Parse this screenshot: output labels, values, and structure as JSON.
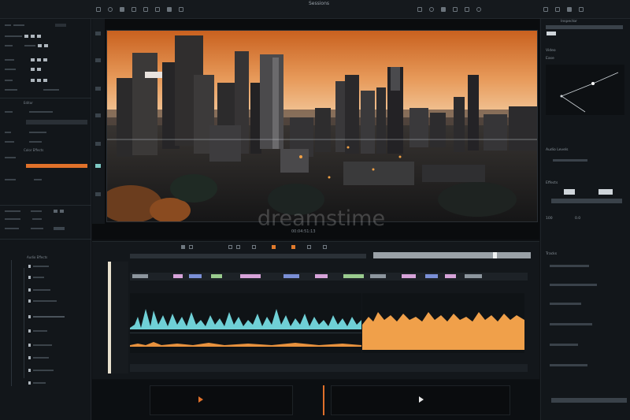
{
  "app": {
    "window_title": "Sessions"
  },
  "viewer": {
    "status_text": "00:04:51:13"
  },
  "left_panel": {
    "section_a": "Editor",
    "section_b": "Audio Effects",
    "section_c": "Color Effects"
  },
  "right_panel": {
    "header": "Inspector",
    "section_video": "Video",
    "section_curve": "Ease",
    "section_audio": "Audio Levels",
    "section_effects": "Effects",
    "section_tracks": "Tracks",
    "value_a": "100",
    "value_b": "0.0"
  },
  "timeline": {
    "scrub_position": 0.77
  },
  "watermark": {
    "text": "dreamstime"
  },
  "colors": {
    "accent": "#e0712a",
    "waveform_a": "#6fd0d6",
    "waveform_b": "#f0a04a",
    "panel_bg": "#12161a"
  },
  "icons": [
    "play-icon",
    "pause-icon",
    "scissor-icon",
    "magnet-icon",
    "gear-icon",
    "search-icon",
    "zoom-icon"
  ]
}
